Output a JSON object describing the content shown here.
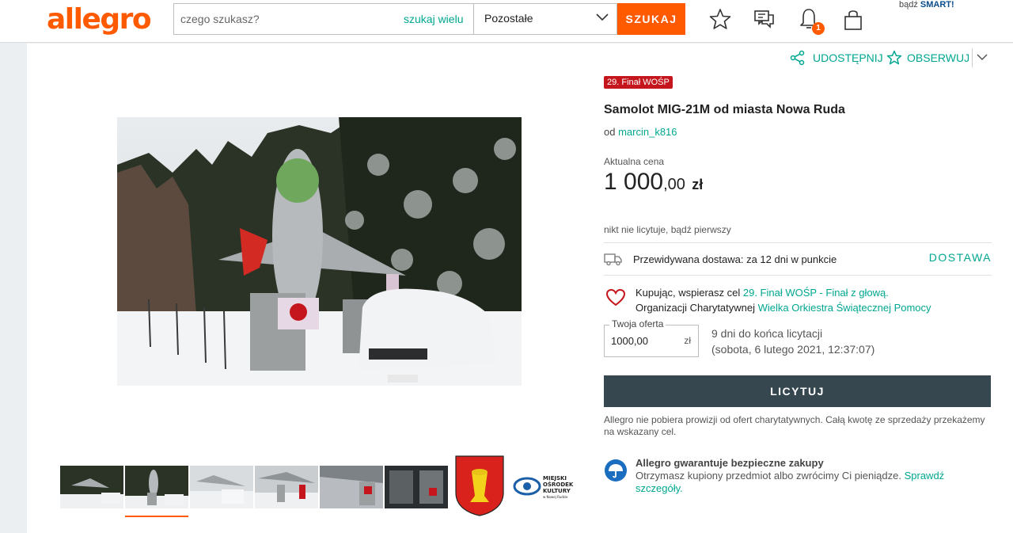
{
  "header": {
    "logo": "allegro",
    "search_placeholder": "czego szukasz?",
    "search_many_label": "szukaj wielu",
    "category_label": "Pozostałe",
    "search_button": "SZUKAJ",
    "notifications_count": "1",
    "smart_prefix": "bądź",
    "smart_label": "SMART!"
  },
  "product": {
    "badge": "29. Finał WOŚP",
    "title": "Samolot MIG-21M od miasta Nowa Ruda",
    "seller_prefix": "od",
    "seller_name": "marcin_k816",
    "share_label": "UDOSTĘPNIJ",
    "watch_label": "OBSERWUJ",
    "price_label": "Aktualna cena",
    "price_main": "1 000",
    "price_fraction": ",00",
    "price_currency": "zł",
    "bidders_text": "nikt nie licytuje, bądź pierwszy",
    "delivery_text": "Przewidywana dostawa: za 12 dni w punkcie",
    "delivery_link": "DOSTAWA",
    "charity_line1_prefix": "Kupując, wspierasz cel",
    "charity_line1_link": "29. Finał WOŚP - Finał z głową.",
    "charity_line2_prefix": "Organizacji Charytatywnej",
    "charity_line2_link": "Wielka Orkiestra Świątecznej Pomocy",
    "offer_legend": "Twoja oferta",
    "offer_value": "1000,00",
    "offer_currency": "zł",
    "time_left": "9 dni do końca licytacji",
    "end_date": "(sobota, 6 lutego 2021, 12:37:07)",
    "bid_button": "LICYTUJ",
    "no_fee_text": "Allegro nie pobiera prowizji od ofert charytatywnych. Całą kwotę ze sprzedaży przekażemy na wskazany cel.",
    "guarantee_head": "Allegro gwarantuje bezpieczne zakupy",
    "guarantee_body": "Otrzymasz kupiony przedmiot albo zwrócimy Ci pieniądze.",
    "guarantee_link": "Sprawdź szczegóły."
  },
  "gallery": {
    "thumbnails": [
      "photo-1",
      "photo-2",
      "photo-3",
      "photo-4",
      "photo-5",
      "photo-6",
      "coat-of-arms",
      "mok-logo"
    ],
    "active_thumbnail": 1,
    "mok_logo_text": [
      "MIEJSKI",
      "OŚRODEK",
      "KULTURY"
    ],
    "mok_logo_subtext": "w Nowej Rudzie"
  },
  "colors": {
    "brand": "#ff5a00",
    "link": "#00a790",
    "button_dark": "#36474f",
    "badge": "#c4161c"
  }
}
